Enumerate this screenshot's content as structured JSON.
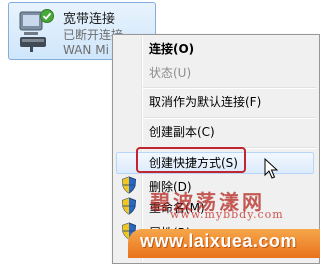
{
  "connection": {
    "name": "宽带连接",
    "status": "已断开连接",
    "device": "WAN Mi"
  },
  "menu": {
    "items": [
      {
        "label": "连接(O)",
        "bold": true
      },
      {
        "label": "状态(U)",
        "disabled": true
      },
      {
        "label": "取消作为默认连接(F)"
      },
      {
        "label": "创建副本(C)"
      },
      {
        "label": "创建快捷方式(S)",
        "highlighted": true
      },
      {
        "label": "删除(D)",
        "shield": true
      },
      {
        "label": "重命名(M)",
        "shield": true
      },
      {
        "label": "属性(R)",
        "shield": true
      }
    ]
  },
  "watermark": {
    "title": "碧波荡漾网",
    "url_top": "www.mybbdy.com",
    "url_bottom": "www.laixuea.com"
  },
  "colors": {
    "highlight_box": "#c0262f",
    "menu_bg": "#f0f0f0",
    "tile_border": "#84acdd",
    "watermark_bar": "#ee8428"
  },
  "icons": [
    "network-adapter-icon",
    "check-badge-icon",
    "shield-icon",
    "mouse-cursor-icon"
  ]
}
